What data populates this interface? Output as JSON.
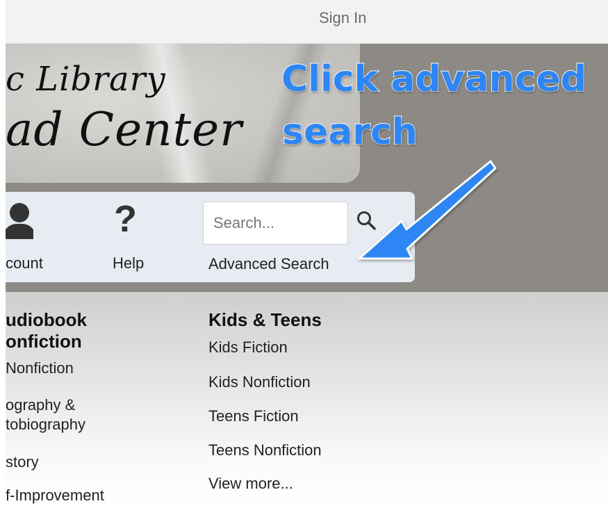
{
  "header": {
    "signin_label": "Sign In"
  },
  "banner": {
    "line1": "c Library",
    "line2": "ad Center"
  },
  "callout": {
    "line1": "Click advanced",
    "line2": "search"
  },
  "nav": {
    "account_label": "count",
    "help_label": "Help",
    "help_icon_glyph": "?",
    "search_placeholder": "Search...",
    "advanced_search_label": "Advanced Search"
  },
  "left_column": {
    "heading_line1": "udiobook",
    "heading_line2": "onfiction",
    "items": [
      {
        "label": " Nonfiction"
      },
      {
        "label_line1": "ography &",
        "label_line2": "tobiography"
      },
      {
        "label": "story"
      },
      {
        "label": "f-Improvement"
      }
    ]
  },
  "kids_teens": {
    "heading": "Kids & Teens",
    "items": [
      "Kids Fiction",
      "Kids Nonfiction",
      "Teens Fiction",
      "Teens Nonfiction",
      "View more..."
    ]
  },
  "colors": {
    "callout": "#2e86f5",
    "panel": "#e6ecf2",
    "hero_bg": "#8d8a85"
  },
  "icons": [
    "account-icon",
    "help-icon",
    "search-icon",
    "arrow-annotation"
  ]
}
